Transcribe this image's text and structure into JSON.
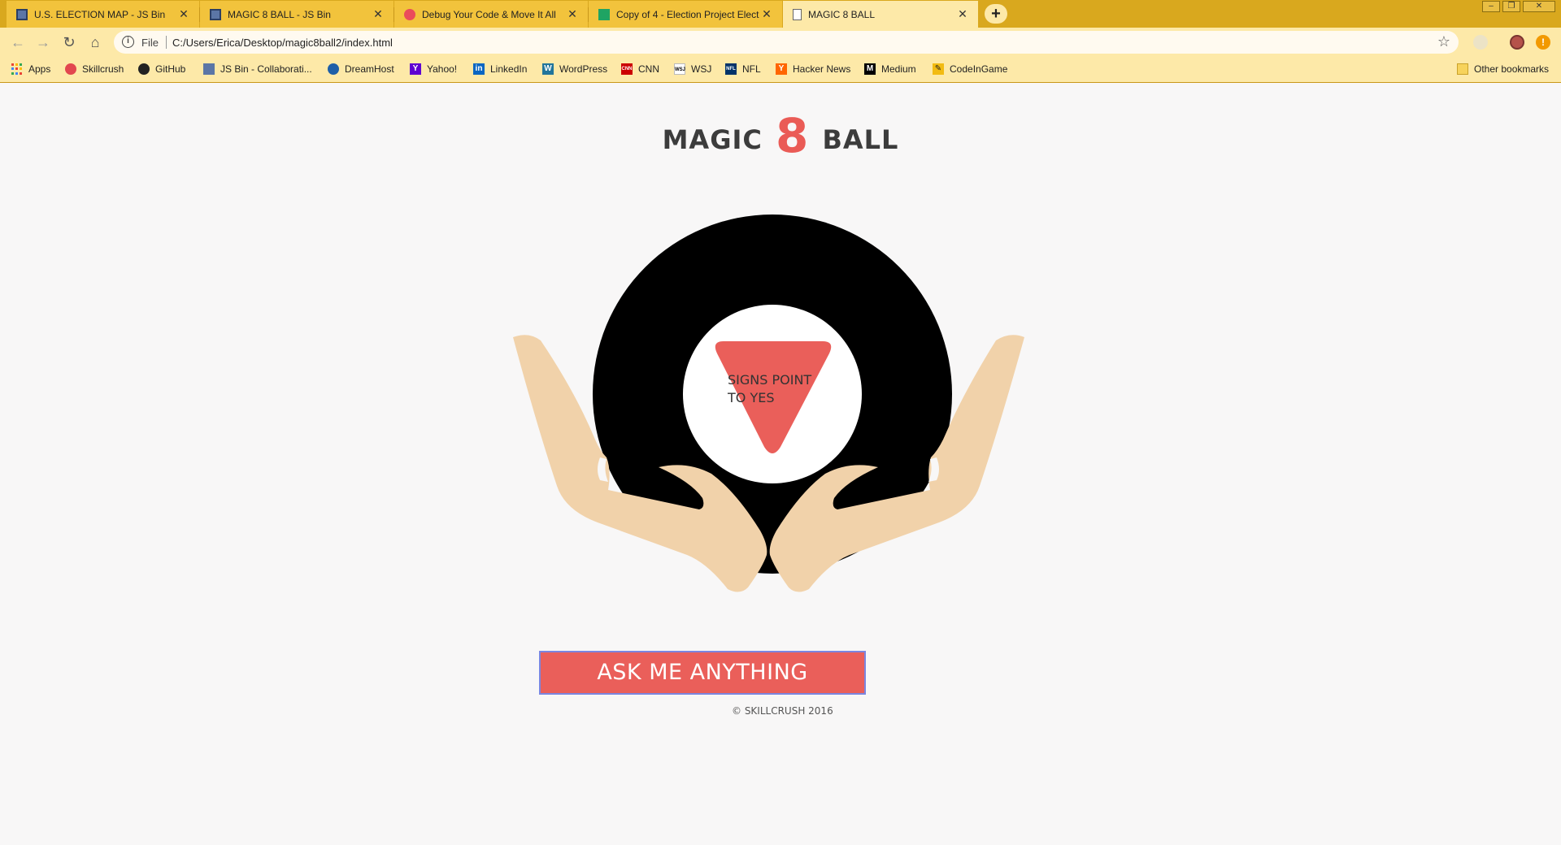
{
  "browser": {
    "tabs": [
      {
        "title": "U.S. ELECTION MAP - JS Bin",
        "icon": "jsbin-icon"
      },
      {
        "title": "MAGIC 8 BALL - JS Bin",
        "icon": "jsbin-icon"
      },
      {
        "title": "Debug Your Code & Move It All",
        "icon": "debug-icon"
      },
      {
        "title": "Copy of 4 - Election Project Elect",
        "icon": "sheets-icon"
      },
      {
        "title": "MAGIC 8 BALL",
        "icon": "document-icon"
      }
    ],
    "active_tab": 4,
    "new_tab_label": "+",
    "address": {
      "scheme_label": "File",
      "url": "C:/Users/Erica/Desktop/magic8ball2/index.html"
    },
    "bookmarks": [
      {
        "label": "Apps",
        "icon": "apps-grid-icon"
      },
      {
        "label": "Skillcrush",
        "icon": "skillcrush-icon"
      },
      {
        "label": "GitHub",
        "icon": "github-icon"
      },
      {
        "label": "JS Bin - Collaborati...",
        "icon": "jsbin-icon"
      },
      {
        "label": "DreamHost",
        "icon": "dreamhost-icon"
      },
      {
        "label": "Yahoo!",
        "icon": "yahoo-icon"
      },
      {
        "label": "LinkedIn",
        "icon": "linkedin-icon"
      },
      {
        "label": "WordPress",
        "icon": "wordpress-icon"
      },
      {
        "label": "CNN",
        "icon": "cnn-icon"
      },
      {
        "label": "WSJ",
        "icon": "wsj-icon"
      },
      {
        "label": "NFL",
        "icon": "nfl-icon"
      },
      {
        "label": "Hacker News",
        "icon": "hackernews-icon"
      },
      {
        "label": "Medium",
        "icon": "medium-icon"
      },
      {
        "label": "CodeInGame",
        "icon": "codeingame-icon"
      }
    ],
    "other_bookmarks": "Other bookmarks"
  },
  "page": {
    "title_left": "MAGIC",
    "title_number": "8",
    "title_right": "BALL",
    "answer": "SIGNS POINT TO YES",
    "button_label": "ASK ME ANYTHING",
    "footer": "© SKILLCRUSH 2016"
  },
  "colors": {
    "chrome": "#d9a81e",
    "toolbar": "#fde9a8",
    "accent": "#ea5b56",
    "ball": "#000000",
    "hands": "#f1d2aa",
    "background": "#f8f7f7"
  }
}
